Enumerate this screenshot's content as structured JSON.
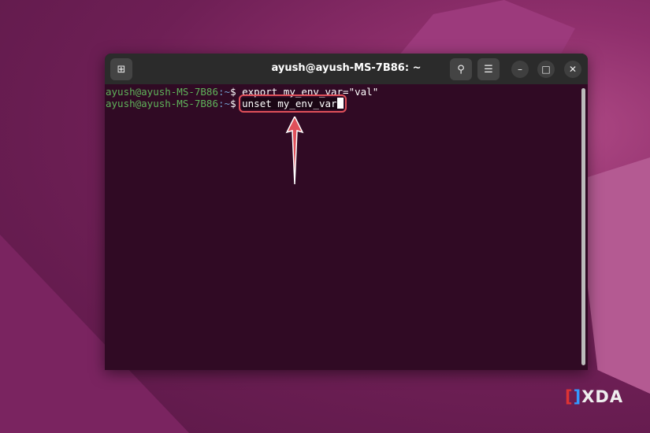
{
  "window": {
    "title": "ayush@ayush-MS-7B86: ~"
  },
  "icons": {
    "new_tab": "new-tab-icon",
    "search": "search-icon",
    "menu": "hamburger-menu-icon",
    "minimize": "minimize-icon",
    "maximize": "maximize-icon",
    "close": "close-icon"
  },
  "terminal": {
    "lines": [
      {
        "user": "ayush@ayush-MS-7B86",
        "path": ":~",
        "prompt": "$ ",
        "command": "export my_env_var=\"val\""
      },
      {
        "user": "ayush@ayush-MS-7B86",
        "path": ":~",
        "prompt": "$ ",
        "command": "unset my_env_var"
      }
    ]
  },
  "watermark": {
    "logo": "XDA"
  },
  "colors": {
    "highlight": "#e0505a",
    "terminal_bg": "#300a24"
  }
}
